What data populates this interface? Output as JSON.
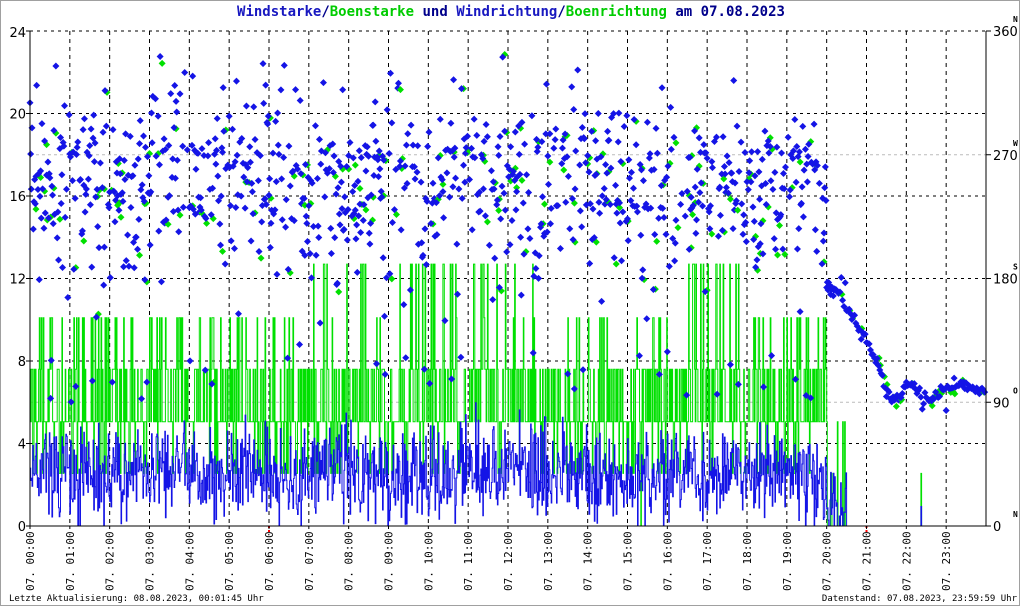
{
  "chart_data": {
    "type": "scatter",
    "title_parts": [
      {
        "text": "Windstarke",
        "color": "blue"
      },
      {
        "text": "/",
        "color": "dark"
      },
      {
        "text": "Boenstarke",
        "color": "green"
      },
      {
        "text": " und ",
        "color": "dark"
      },
      {
        "text": "Windrichtung",
        "color": "blue"
      },
      {
        "text": "/",
        "color": "dark"
      },
      {
        "text": "Boenrichtung",
        "color": "green"
      },
      {
        "text": " am 07.08.2023",
        "color": "dark"
      }
    ],
    "left_axis": {
      "ylim": [
        0,
        24
      ],
      "ticks": [
        "0",
        "4",
        "8",
        "12",
        "16",
        "20",
        "24"
      ]
    },
    "right_axis": {
      "ylim": [
        0,
        360
      ],
      "ticks": [
        "0",
        "90",
        "180",
        "270",
        "360"
      ],
      "compass": [
        "N",
        "O",
        "S",
        "W",
        "N"
      ]
    },
    "x_ticks": [
      "07. 00:00",
      "07. 01:00",
      "07. 02:00",
      "07. 03:00",
      "07. 04:00",
      "07. 05:00",
      "07. 06:00",
      "07. 07:00",
      "07. 08:00",
      "07. 09:00",
      "07. 10:00",
      "07. 11:00",
      "07. 12:00",
      "07. 13:00",
      "07. 14:00",
      "07. 15:00",
      "07. 16:00",
      "07. 17:00",
      "07. 18:00",
      "07. 19:00",
      "07. 20:00",
      "07. 21:00",
      "07. 22:00",
      "07. 23:00"
    ],
    "xlim_hours": [
      0,
      24
    ],
    "sun_markers_hours": [
      6,
      21
    ],
    "hourly_wind_mean": [
      2.6,
      2.4,
      2.5,
      2.7,
      2.5,
      2.6,
      2.3,
      2.8,
      2.6,
      2.5,
      2.7,
      2.8,
      2.9,
      2.6,
      2.4,
      2.5,
      2.6,
      2.7,
      2.5,
      2.4,
      0.4,
      0,
      0.1,
      0
    ],
    "hourly_gust_level": [
      10.1,
      10.1,
      10.1,
      10.1,
      10.1,
      10.1,
      10.1,
      12.7,
      12.7,
      12.7,
      12.7,
      12.7,
      12.7,
      10.1,
      10.1,
      10.1,
      12.7,
      12.7,
      10.1,
      10.1,
      5.0,
      0,
      2.5,
      2.5
    ],
    "hourly_direction_mean": [
      250,
      255,
      255,
      260,
      255,
      260,
      250,
      255,
      250,
      255,
      255,
      255,
      260,
      260,
      250,
      245,
      245,
      250,
      245,
      245,
      0,
      0,
      0,
      0
    ],
    "late_direction_trend": [
      [
        20.0,
        175
      ],
      [
        20.3,
        168
      ],
      [
        20.6,
        155
      ],
      [
        21.0,
        135
      ],
      [
        21.3,
        118
      ],
      [
        21.5,
        95
      ],
      [
        21.8,
        92
      ],
      [
        22.0,
        105
      ],
      [
        22.3,
        100
      ],
      [
        22.6,
        92
      ],
      [
        22.9,
        100
      ],
      [
        23.2,
        103
      ],
      [
        23.6,
        101
      ],
      [
        24.0,
        97
      ]
    ],
    "colors": {
      "wind": "#1414e6",
      "gust": "#00e000",
      "title": "#00008b",
      "sun": "#ff0000"
    }
  },
  "footer": {
    "last_update": "Letzte Aktualisierung: 08.08.2023, 00:01:45 Uhr",
    "data_state": "Datenstand: 07.08.2023, 23:59:59 Uhr"
  }
}
